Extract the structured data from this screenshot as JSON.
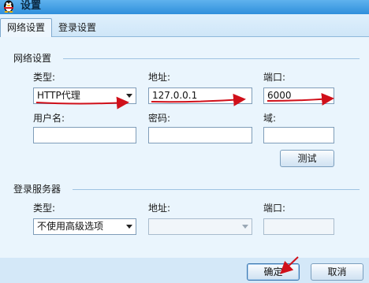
{
  "window": {
    "title": "设置"
  },
  "tabs": [
    {
      "label": "网络设置",
      "active": true
    },
    {
      "label": "登录设置",
      "active": false
    }
  ],
  "network_settings": {
    "group_title": "网络设置",
    "type_label": "类型:",
    "type_value": "HTTP代理",
    "address_label": "地址:",
    "address_value": "127.0.0.1",
    "port_label": "端口:",
    "port_value": "6000",
    "username_label": "用户名:",
    "username_value": "",
    "password_label": "密码:",
    "password_value": "",
    "domain_label": "域:",
    "domain_value": "",
    "test_button": "测试"
  },
  "login_server": {
    "group_title": "登录服务器",
    "type_label": "类型:",
    "type_value": "不使用高级选项",
    "address_label": "地址:",
    "address_value": "",
    "port_label": "端口:",
    "port_value": ""
  },
  "footer": {
    "ok_button": "确定",
    "cancel_button": "取消"
  },
  "colors": {
    "titlebar": "#2f8fdc",
    "panel": "#eaf5fd",
    "annotation_arrow": "#d0101a"
  },
  "icons": [
    "qq-penguin-icon",
    "dropdown-arrow-icon"
  ]
}
